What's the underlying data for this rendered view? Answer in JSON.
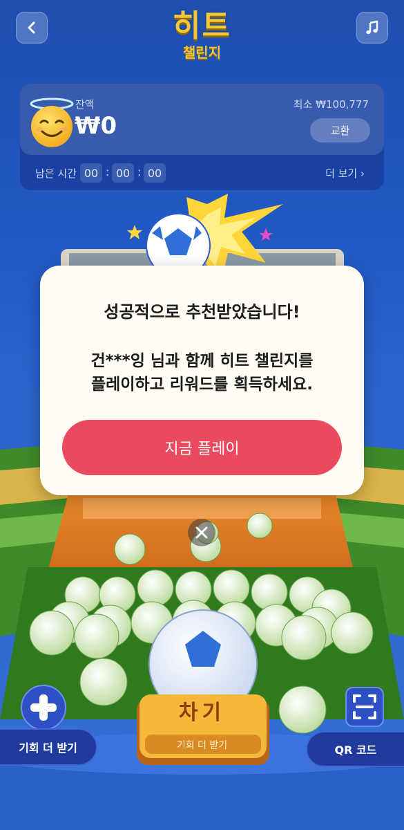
{
  "header": {
    "title_main": "히트",
    "title_sub": "챌린지"
  },
  "balance": {
    "label": "잔액",
    "amount": "₩0",
    "minimum": "최소  ₩100,777",
    "exchange_label": "교환",
    "time_label": "남은 시간",
    "time": [
      "00",
      "00",
      "00"
    ],
    "more_label": "더 보기 ›"
  },
  "modal": {
    "title": "성공적으로 추천받았습니다!",
    "body_line1": "건***잉 님과 함께 히트 챌린지를",
    "body_line2": "플레이하고 리워드를 획득하세요.",
    "play_label": "지금 플레이"
  },
  "controls": {
    "more_chances_label": "기회 더 받기",
    "kick_label": "차기",
    "kick_sub_label": "기회 더 받기",
    "qr_label": "QR 코드"
  },
  "colors": {
    "background": "#2259c4",
    "title_gold": "#f3c73a",
    "play_button": "#ea4a5f",
    "modal_bg": "#fffdf3"
  }
}
